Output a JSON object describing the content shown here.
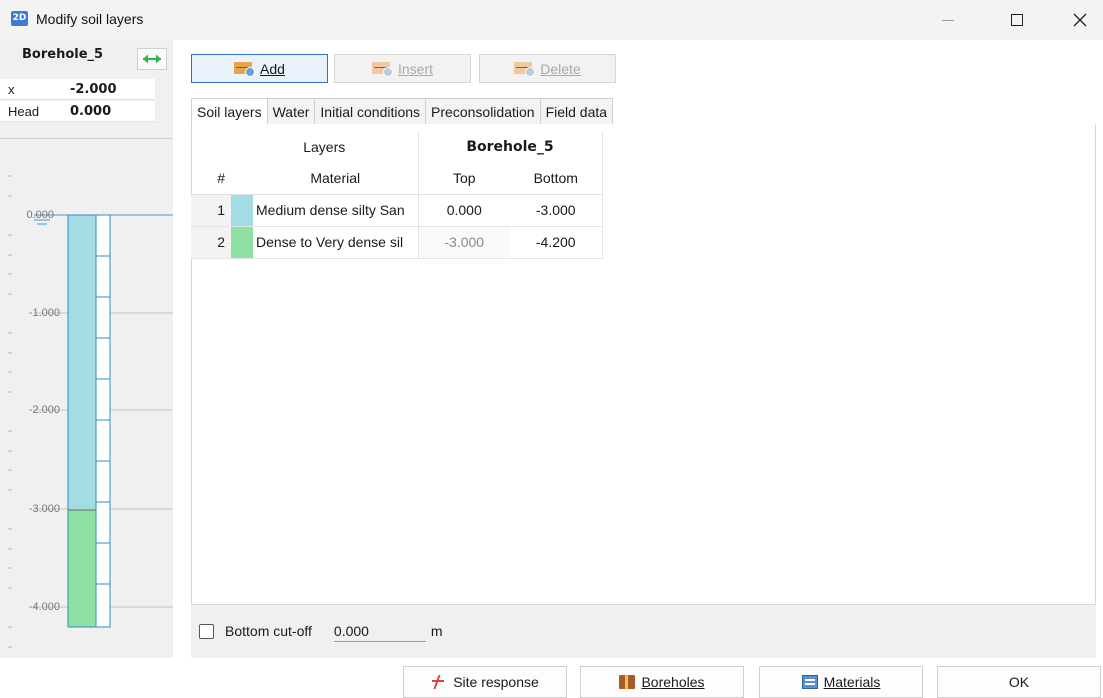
{
  "window": {
    "title": "Modify soil layers",
    "app_icon_text": "2D"
  },
  "left_panel": {
    "borehole_name": "Borehole_5",
    "x_label": "x",
    "x_value": "-2.000",
    "head_label": "Head",
    "head_value": "0.000",
    "depth_labels": [
      "0.000",
      "-1.000",
      "-2.000",
      "-3.000",
      "-4.000"
    ],
    "layer_colors": [
      "#a3dde3",
      "#8fe0a3"
    ]
  },
  "toolbar": {
    "add_label": "Add",
    "insert_label": "Insert",
    "delete_label": "Delete"
  },
  "tabs": [
    {
      "label": "Soil layers",
      "active": true
    },
    {
      "label": "Water",
      "active": false
    },
    {
      "label": "Initial conditions",
      "active": false
    },
    {
      "label": "Preconsolidation",
      "active": false
    },
    {
      "label": "Field data",
      "active": false
    }
  ],
  "table": {
    "group_header_left": "Layers",
    "group_header_right": "Borehole_5",
    "col_num": "#",
    "col_material": "Material",
    "col_top": "Top",
    "col_bottom": "Bottom",
    "rows": [
      {
        "num": "1",
        "color": "#a3dde3",
        "material": "Medium dense silty San",
        "top": "0.000",
        "bottom": "-3.000"
      },
      {
        "num": "2",
        "color": "#8fe0a3",
        "material": "Dense to Very dense sil",
        "top": "-3.000",
        "bottom": "-4.200"
      }
    ]
  },
  "cutoff": {
    "label": "Bottom cut-off",
    "value": "0.000",
    "unit": "m",
    "checked": false
  },
  "footer": {
    "site_response_label": "Site response",
    "boreholes_label": "Boreholes",
    "materials_label": "Materials",
    "ok_label": "OK"
  }
}
